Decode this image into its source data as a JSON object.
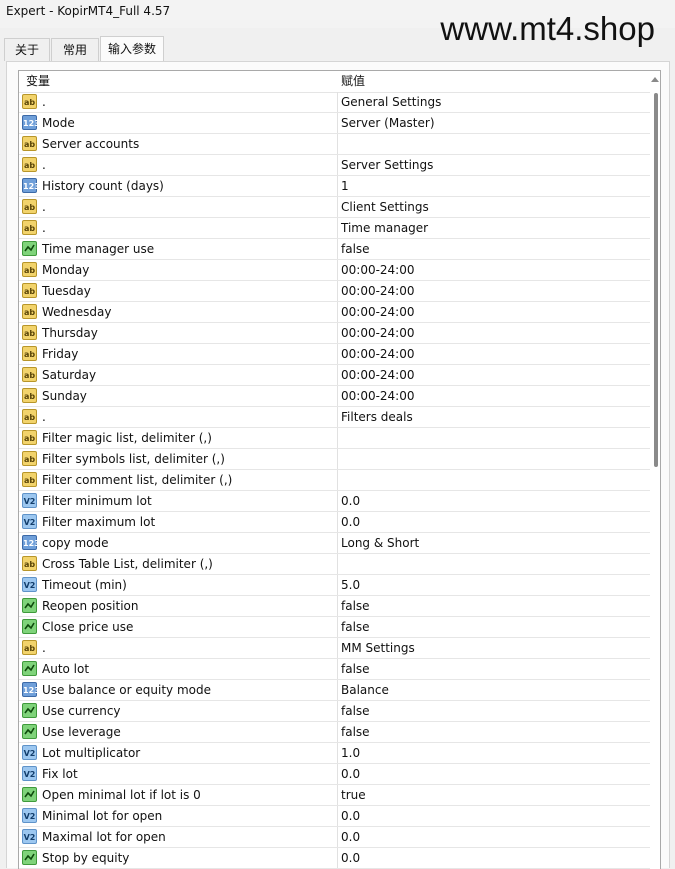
{
  "window": {
    "title": "Expert - KopirMT4_Full 4.57"
  },
  "watermark": "www.mt4.shop",
  "tabs": [
    {
      "label": "关于",
      "active": false
    },
    {
      "label": "常用",
      "active": false
    },
    {
      "label": "输入参数",
      "active": true
    }
  ],
  "table": {
    "headers": {
      "variable": "变量",
      "value": "赋值"
    },
    "rows": [
      {
        "icon": "ab",
        "name": ".",
        "value": "General Settings"
      },
      {
        "icon": "123",
        "name": "Mode",
        "value": "Server (Master)"
      },
      {
        "icon": "ab",
        "name": "Server accounts",
        "value": ""
      },
      {
        "icon": "ab",
        "name": ".",
        "value": "Server Settings"
      },
      {
        "icon": "123",
        "name": "History count (days)",
        "value": "1"
      },
      {
        "icon": "ab",
        "name": ".",
        "value": "Client Settings"
      },
      {
        "icon": "ab",
        "name": ".",
        "value": "Time manager"
      },
      {
        "icon": "bool",
        "name": "Time manager use",
        "value": "false"
      },
      {
        "icon": "ab",
        "name": "Monday",
        "value": "00:00-24:00"
      },
      {
        "icon": "ab",
        "name": "Tuesday",
        "value": "00:00-24:00"
      },
      {
        "icon": "ab",
        "name": "Wednesday",
        "value": "00:00-24:00"
      },
      {
        "icon": "ab",
        "name": "Thursday",
        "value": "00:00-24:00"
      },
      {
        "icon": "ab",
        "name": "Friday",
        "value": "00:00-24:00"
      },
      {
        "icon": "ab",
        "name": "Saturday",
        "value": "00:00-24:00"
      },
      {
        "icon": "ab",
        "name": "Sunday",
        "value": "00:00-24:00"
      },
      {
        "icon": "ab",
        "name": ".",
        "value": "Filters deals"
      },
      {
        "icon": "ab",
        "name": "Filter magic list, delimiter (,)",
        "value": ""
      },
      {
        "icon": "ab",
        "name": "Filter symbols list, delimiter (,)",
        "value": ""
      },
      {
        "icon": "ab",
        "name": "Filter comment list, delimiter (,)",
        "value": ""
      },
      {
        "icon": "v2",
        "name": "Filter minimum lot",
        "value": "0.0"
      },
      {
        "icon": "v2",
        "name": "Filter maximum lot",
        "value": "0.0"
      },
      {
        "icon": "123",
        "name": "copy mode",
        "value": "Long & Short"
      },
      {
        "icon": "ab",
        "name": "Cross Table List, delimiter (,)",
        "value": ""
      },
      {
        "icon": "v2",
        "name": "Timeout (min)",
        "value": "5.0"
      },
      {
        "icon": "bool",
        "name": "Reopen position",
        "value": "false"
      },
      {
        "icon": "bool",
        "name": "Close price use",
        "value": "false"
      },
      {
        "icon": "ab",
        "name": ".",
        "value": "MM Settings"
      },
      {
        "icon": "bool",
        "name": "Auto lot",
        "value": "false"
      },
      {
        "icon": "123",
        "name": "Use balance or equity mode",
        "value": "Balance"
      },
      {
        "icon": "bool",
        "name": "Use currency",
        "value": "false"
      },
      {
        "icon": "bool",
        "name": "Use leverage",
        "value": "false"
      },
      {
        "icon": "v2",
        "name": "Lot multiplicator",
        "value": "1.0"
      },
      {
        "icon": "v2",
        "name": "Fix lot",
        "value": "0.0"
      },
      {
        "icon": "bool",
        "name": "Open minimal lot if lot is 0",
        "value": "true"
      },
      {
        "icon": "v2",
        "name": "Minimal lot for open",
        "value": "0.0"
      },
      {
        "icon": "v2",
        "name": "Maximal lot for open",
        "value": "0.0"
      },
      {
        "icon": "bool",
        "name": "Stop by equity",
        "value": "0.0"
      }
    ]
  },
  "icon_labels": {
    "ab": "ab",
    "123": "123",
    "v2": "V2",
    "bool": ""
  },
  "icon_names": {
    "ab": "string-type-icon",
    "123": "integer-type-icon",
    "v2": "double-type-icon",
    "bool": "bool-type-icon"
  }
}
